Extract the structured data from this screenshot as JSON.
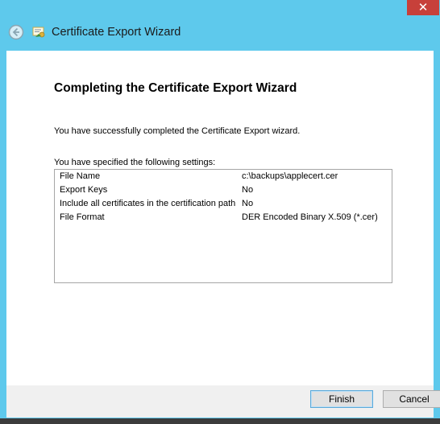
{
  "window": {
    "title": "Certificate Export Wizard",
    "close_label": "✕"
  },
  "wizard": {
    "heading": "Completing the Certificate Export Wizard",
    "success_text": "You have successfully completed the Certificate Export wizard.",
    "specified_text": "You have specified the following settings:",
    "settings": [
      {
        "name": "File Name",
        "value": "c:\\backups\\applecert.cer"
      },
      {
        "name": "Export Keys",
        "value": "No"
      },
      {
        "name": "Include all certificates in the certification path",
        "value": "No"
      },
      {
        "name": "File Format",
        "value": "DER Encoded Binary X.509 (*.cer)"
      }
    ]
  },
  "footer": {
    "finish_label": "Finish",
    "cancel_label": "Cancel"
  },
  "icons": {
    "back": "back-arrow-icon",
    "title": "certificate-icon"
  },
  "colors": {
    "frame": "#5ec9ec",
    "close": "#c7403a",
    "content_bg": "#ffffff",
    "footer_bg": "#f0f0f0"
  }
}
